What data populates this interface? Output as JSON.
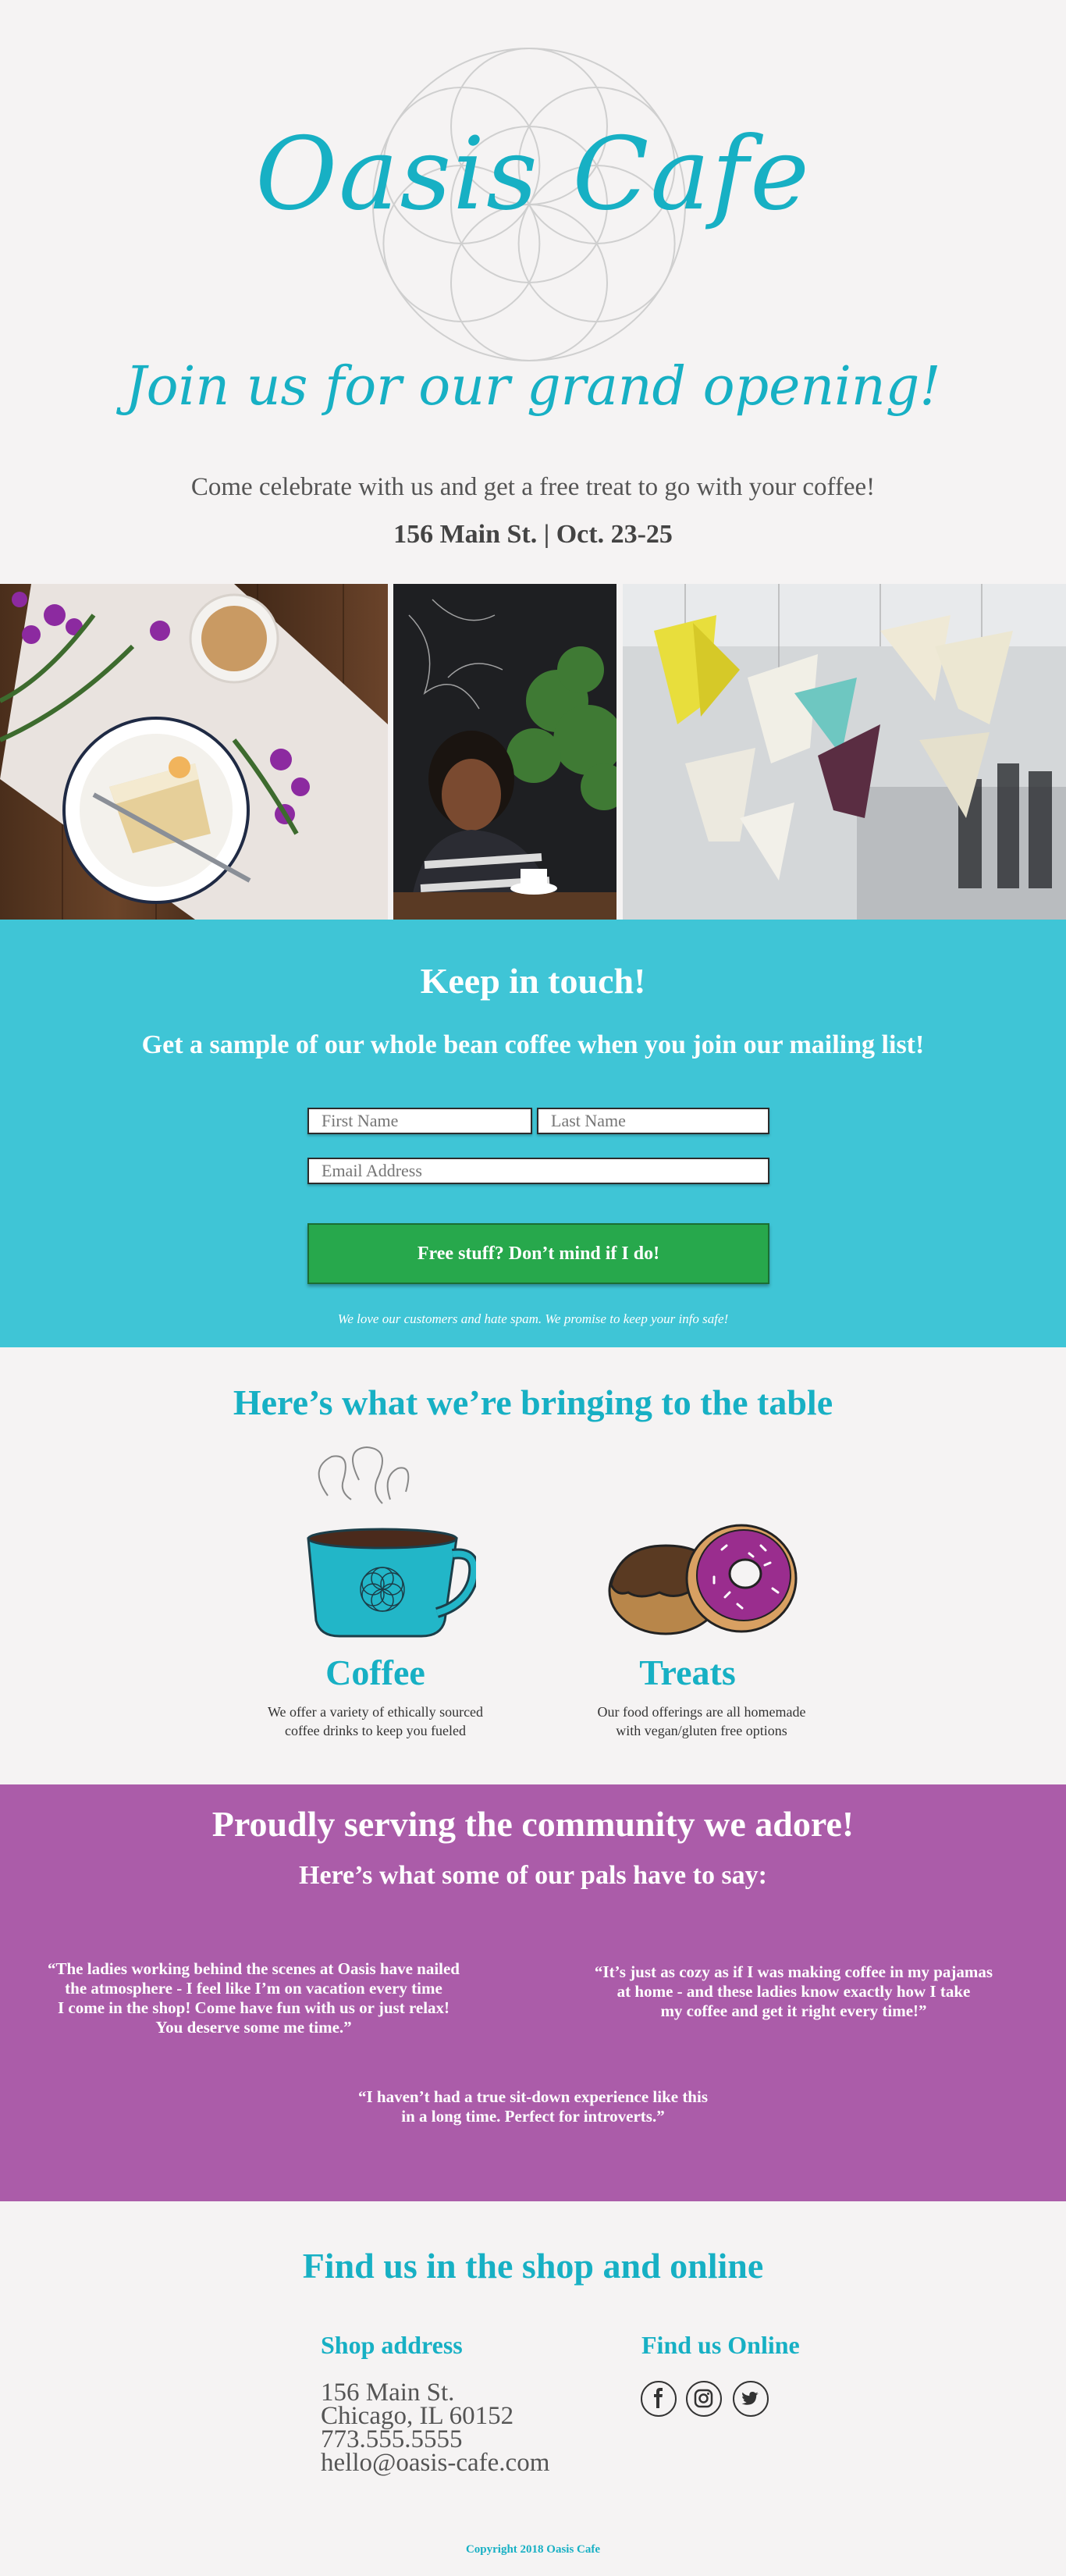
{
  "hero": {
    "brand": "Oasis Cafe",
    "heading": "Join us for our grand opening!",
    "subheading": "Come celebrate with us and get a free treat to go with your coffee!",
    "details": "156 Main St.  |  Oct. 23-25",
    "accent_color": "#17b0c4"
  },
  "photos": [
    {
      "name": "cake-and-coffee-photo"
    },
    {
      "name": "woman-in-cafe-photo"
    },
    {
      "name": "origami-birds-photo"
    }
  ],
  "signup": {
    "title": "Keep in touch!",
    "subtitle": "Get a sample of  our whole bean coffee when you join our mailing list!",
    "first_name_placeholder": "First Name",
    "last_name_placeholder": "Last Name",
    "email_placeholder": "Email Address",
    "button_label": "Free stuff? Don’t mind if I do!",
    "note": "We love our customers and hate spam. We promise to keep your info safe!",
    "background_color": "#3fc5d6",
    "button_color": "#27a84c"
  },
  "offerings": {
    "title": "Here’s what we’re bringing to the table",
    "coffee": {
      "name": "Coffee",
      "desc_line1": "We offer a variety of  ethically sourced",
      "desc_line2": "coffee drinks to keep you fueled",
      "icon": "coffee-cup-icon"
    },
    "treats": {
      "name": "Treats",
      "desc_line1": "Our food offerings are all homemade",
      "desc_line2": "with vegan/gluten free options",
      "icon": "donuts-icon"
    }
  },
  "testimonials": {
    "title": "Proudly serving the community we adore!",
    "subtitle": "Here’s what some of  our pals have to say:",
    "background_color": "#ab5ca9",
    "quotes": [
      {
        "lines": [
          "“The ladies working behind the scenes at Oasis have nailed",
          "the atmosphere - I feel like I’m on vacation every time",
          "I come in the shop! Come have fun with us or just relax!",
          "You deserve some me time.”"
        ]
      },
      {
        "lines": [
          "“It’s just as cozy as if  I was making coffee in my pajamas",
          "at home - and these ladies know exactly how I take",
          "my coffee and get it right every time!”"
        ]
      },
      {
        "lines": [
          "“I haven’t had a true sit-down experience like this",
          "in a long time. Perfect for introverts.”"
        ]
      }
    ]
  },
  "findus": {
    "title": "Find us in the shop and online",
    "address_heading": "Shop address",
    "online_heading": "Find us Online",
    "street": "156 Main St.",
    "city": "Chicago, IL 60152",
    "phone": "773.555.5555",
    "email": "hello@oasis-cafe.com",
    "socials": [
      "facebook-icon",
      "instagram-icon",
      "twitter-icon"
    ],
    "copyright": "Copyright 2018 Oasis Cafe"
  }
}
